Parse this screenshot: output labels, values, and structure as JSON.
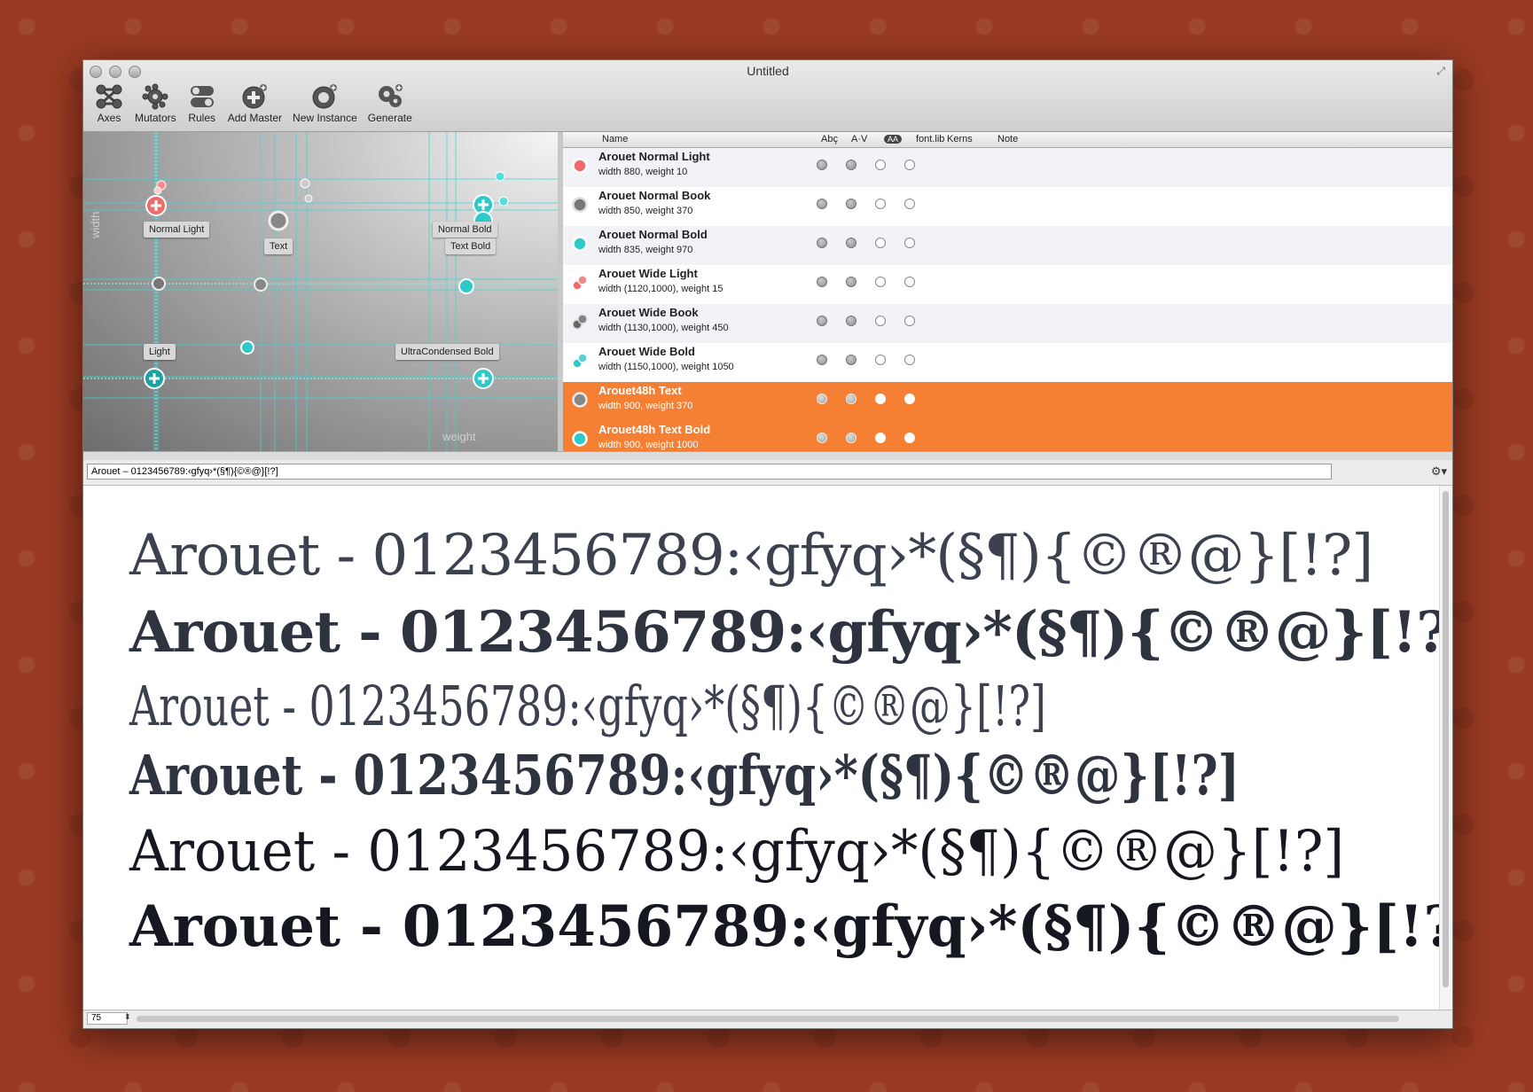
{
  "window": {
    "title": "Untitled"
  },
  "toolbar": [
    {
      "label": "Axes",
      "icon": "axes-icon"
    },
    {
      "label": "Mutators",
      "icon": "mutators-icon"
    },
    {
      "label": "Rules",
      "icon": "rules-icon"
    },
    {
      "label": "Add Master",
      "icon": "add-master-icon"
    },
    {
      "label": "New Instance",
      "icon": "new-instance-icon"
    },
    {
      "label": "Generate",
      "icon": "generate-icon"
    }
  ],
  "designspace": {
    "axis_x": "weight",
    "axis_y": "width",
    "labels": [
      "Normal Light",
      "Text",
      "Normal Bold",
      "Text Bold",
      "Light",
      "UltraCondensed Bold"
    ]
  },
  "table": {
    "columns": {
      "name": "Name",
      "abc": "Abç",
      "av": "A·V",
      "aa": "AA",
      "fontlib": "font.lib",
      "kerns": "Kerns",
      "note": "Note"
    },
    "rows": [
      {
        "name": "Arouet Normal Light",
        "desc": "width 880, weight 10",
        "icon": "master-light-icon",
        "selected": false,
        "flags": [
          true,
          true,
          false,
          false
        ]
      },
      {
        "name": "Arouet Normal Book",
        "desc": "width 850, weight 370",
        "icon": "master-book-icon",
        "selected": false,
        "flags": [
          true,
          true,
          false,
          false
        ]
      },
      {
        "name": "Arouet Normal Bold",
        "desc": "width 835, weight 970",
        "icon": "master-bold-icon",
        "selected": false,
        "flags": [
          true,
          true,
          false,
          false
        ]
      },
      {
        "name": "Arouet Wide Light",
        "desc": "width (1120,1000), weight 15",
        "icon": "wide-light-icon",
        "selected": false,
        "flags": [
          true,
          true,
          false,
          false
        ]
      },
      {
        "name": "Arouet Wide Book",
        "desc": "width (1130,1000), weight 450",
        "icon": "wide-book-icon",
        "selected": false,
        "flags": [
          true,
          true,
          false,
          false
        ]
      },
      {
        "name": "Arouet Wide Bold",
        "desc": "width (1150,1000), weight 1050",
        "icon": "wide-bold-icon",
        "selected": false,
        "flags": [
          true,
          true,
          false,
          false
        ]
      },
      {
        "name": "Arouet48h Text",
        "desc": "width 900, weight 370",
        "icon": "instance-text-icon",
        "selected": true,
        "flags": [
          true,
          true,
          true,
          true
        ]
      },
      {
        "name": "Arouet48h Text Bold",
        "desc": "width 900, weight 1000",
        "icon": "instance-textbold-icon",
        "selected": true,
        "flags": [
          true,
          true,
          true,
          true
        ]
      }
    ]
  },
  "sample_text": "Arouet – 0123456789:‹gfyq›*(§¶){©®@}[!?]",
  "preview": {
    "line_text": "Arouet - 0123456789:‹gfyq›*(§¶){©®@}[!?]"
  },
  "status": {
    "zoom": "75"
  },
  "colors": {
    "selection": "#f57f33",
    "accent": "#2ec9c9",
    "background": "#9a3a22"
  }
}
